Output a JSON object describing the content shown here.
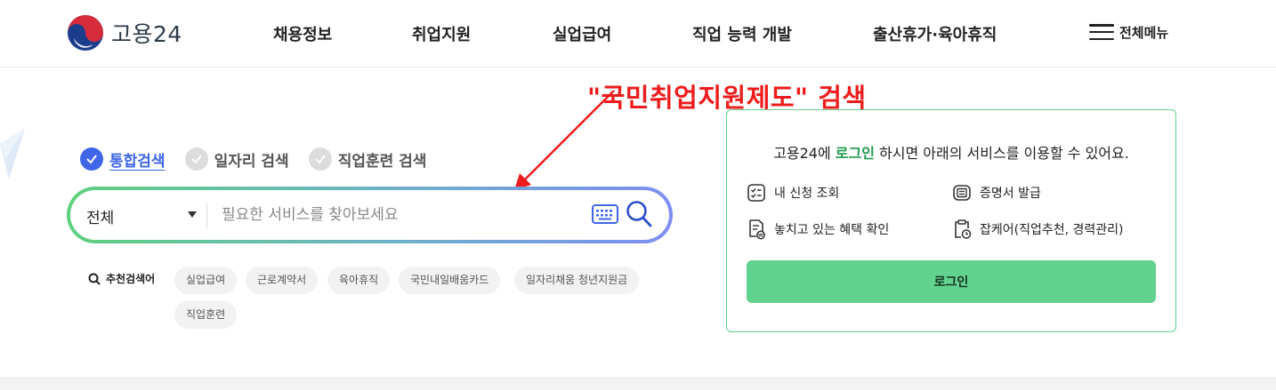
{
  "header": {
    "logo_text": "고용24",
    "nav": [
      "채용정보",
      "취업지원",
      "실업급여",
      "직업 능력 개발",
      "출산휴가·육아휴직"
    ],
    "all_menu_label": "전체메뉴"
  },
  "annotation": {
    "text": "\"국민취업지원제도\" 검색",
    "color": "#ee1c1c"
  },
  "search": {
    "tabs": [
      {
        "label": "통합검색",
        "selected": true
      },
      {
        "label": "일자리 검색",
        "selected": false
      },
      {
        "label": "직업훈련 검색",
        "selected": false
      }
    ],
    "scope_value": "전체",
    "placeholder": "필요한 서비스를 찾아보세요",
    "value": "",
    "recommend_title": "추천검색어",
    "keywords": [
      "실업급여",
      "근로계약서",
      "육아휴직",
      "국민내일배움카드",
      "일자리채움 청년지원금",
      "직업훈련"
    ]
  },
  "login_panel": {
    "msg_prefix": "고용24에 ",
    "msg_link": "로그인",
    "msg_suffix": " 하시면 아래의 서비스를 이용할 수 있어요.",
    "services": [
      {
        "label": "내 신청 조회",
        "icon": "checklist-icon"
      },
      {
        "label": "증명서 발급",
        "icon": "certificate-icon"
      },
      {
        "label": "놓치고 있는 혜택 확인",
        "icon": "benefit-document-icon"
      },
      {
        "label": "잡케어(직업추천, 경력관리)",
        "icon": "clipboard-clock-icon"
      }
    ],
    "button_label": "로그인"
  },
  "colors": {
    "accent_blue": "#3e66e7",
    "accent_green": "#62d28f",
    "login_link_green": "#1f9a4d"
  }
}
